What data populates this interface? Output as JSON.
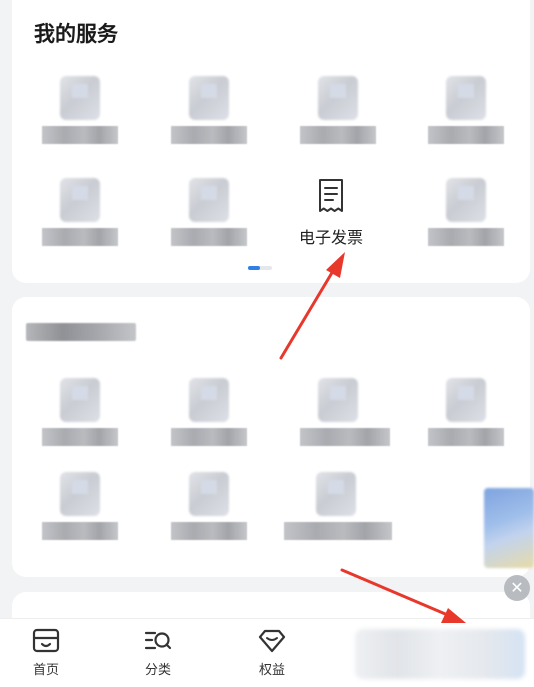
{
  "services": {
    "title": "我的服务",
    "invoice_label": "电子发票",
    "invoice_icon": "receipt-icon"
  },
  "tabbar": {
    "home_label": "首页",
    "category_label": "分类",
    "rights_label": "权益"
  },
  "colors": {
    "accent": "#2f7fe6",
    "arrow": "#e8382c"
  }
}
